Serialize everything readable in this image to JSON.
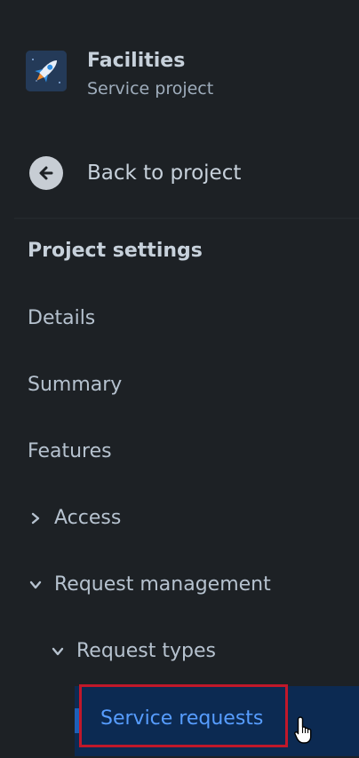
{
  "project": {
    "name": "Facilities",
    "type": "Service project",
    "avatar_icon": "rocket-icon"
  },
  "back": {
    "label": "Back to project",
    "icon": "arrow-left-icon"
  },
  "settings": {
    "title": "Project settings",
    "items": {
      "details": "Details",
      "summary": "Summary",
      "features": "Features",
      "access": "Access",
      "request_management": "Request management",
      "request_types": "Request types",
      "service_requests": "Service requests"
    }
  },
  "colors": {
    "background": "#1d2125",
    "selected_background": "#0c2a52",
    "selected_text": "#579dff",
    "highlight_outline": "#c0182a"
  }
}
